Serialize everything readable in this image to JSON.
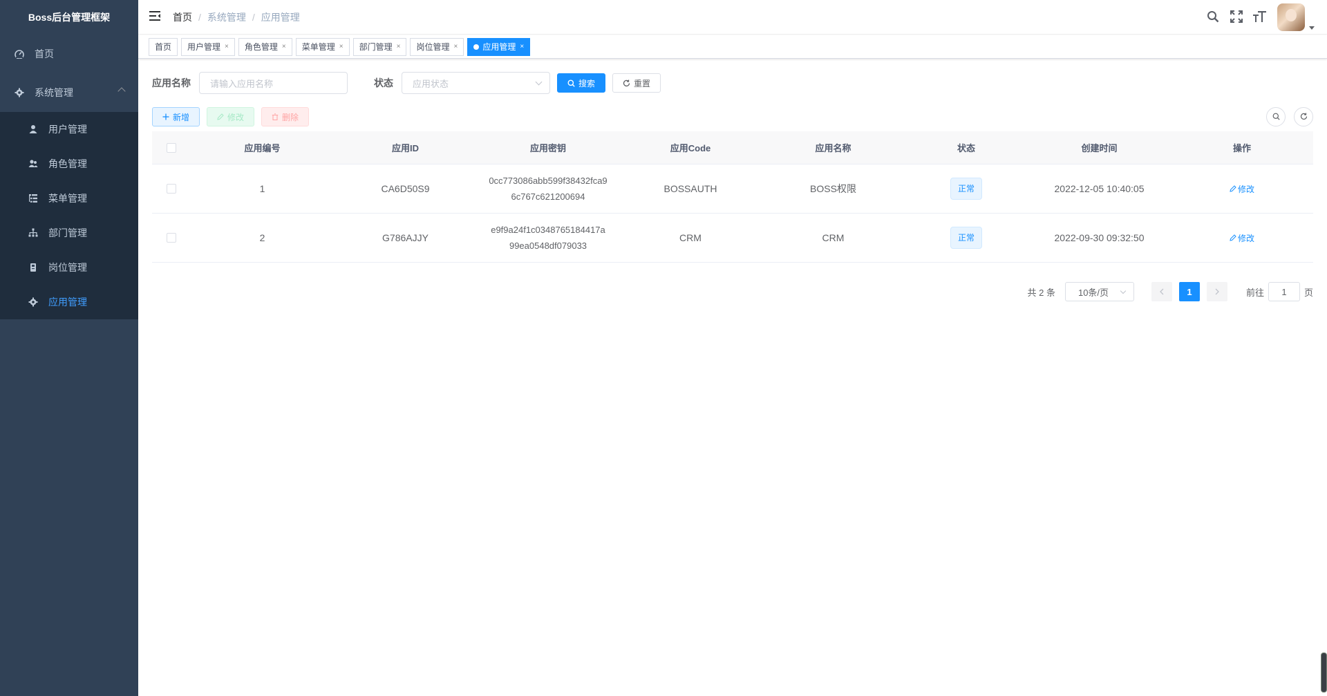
{
  "app": {
    "title": "Boss后台管理框架"
  },
  "sidebar": {
    "home": {
      "label": "首页",
      "icon": "dashboard-icon"
    },
    "system": {
      "label": "系统管理",
      "icon": "gear-icon"
    },
    "items": [
      {
        "label": "用户管理",
        "icon": "user-icon"
      },
      {
        "label": "角色管理",
        "icon": "peoples-icon"
      },
      {
        "label": "菜单管理",
        "icon": "tree-table-icon"
      },
      {
        "label": "部门管理",
        "icon": "org-tree-icon"
      },
      {
        "label": "岗位管理",
        "icon": "post-icon"
      },
      {
        "label": "应用管理",
        "icon": "gear-icon",
        "active": true
      }
    ]
  },
  "breadcrumb": [
    "首页",
    "系统管理",
    "应用管理"
  ],
  "tags": [
    {
      "label": "首页",
      "closable": false
    },
    {
      "label": "用户管理",
      "closable": true
    },
    {
      "label": "角色管理",
      "closable": true
    },
    {
      "label": "菜单管理",
      "closable": true
    },
    {
      "label": "部门管理",
      "closable": true
    },
    {
      "label": "岗位管理",
      "closable": true
    },
    {
      "label": "应用管理",
      "closable": true,
      "active": true
    }
  ],
  "tag_close": "×",
  "search": {
    "name_label": "应用名称",
    "name_placeholder": "请输入应用名称",
    "status_label": "状态",
    "status_placeholder": "应用状态",
    "search_button": "搜索",
    "reset_button": "重置"
  },
  "toolbar": {
    "add": "新增",
    "edit": "修改",
    "delete": "删除"
  },
  "table": {
    "headers": [
      "应用编号",
      "应用ID",
      "应用密钥",
      "应用Code",
      "应用名称",
      "状态",
      "创建时间",
      "操作"
    ],
    "rows": [
      {
        "no": "1",
        "app_id": "CA6D50S9",
        "secret_line1": "0cc773086abb599f38432fca9",
        "secret_line2": "6c767c621200694",
        "code": "BOSSAUTH",
        "name": "BOSS权限",
        "status": "正常",
        "created": "2022-12-05 10:40:05",
        "action": "修改"
      },
      {
        "no": "2",
        "app_id": "G786AJJY",
        "secret_line1": "e9f9a24f1c0348765184417a",
        "secret_line2": "99ea0548df079033",
        "code": "CRM",
        "name": "CRM",
        "status": "正常",
        "created": "2022-09-30 09:32:50",
        "action": "修改"
      }
    ]
  },
  "pagination": {
    "total": "共 2 条",
    "page_size": "10条/页",
    "current_page": "1",
    "goto_label": "前往",
    "goto_value": "1",
    "page_suffix": "页"
  },
  "colors": {
    "sidebar_bg": "#304156",
    "submenu_bg": "#1f2d3d",
    "primary": "#1890ff",
    "active_menu": "#409eff"
  }
}
